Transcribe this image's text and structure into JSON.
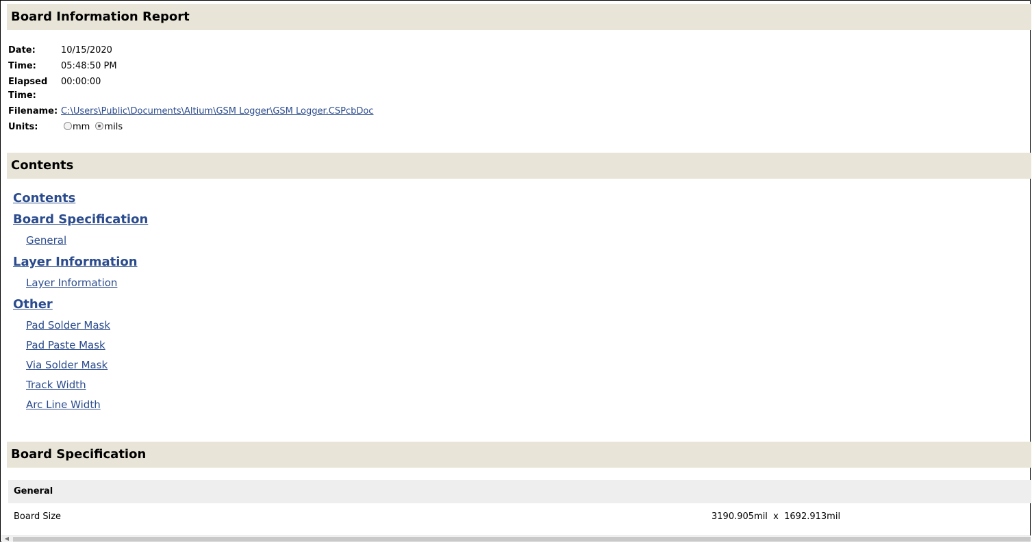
{
  "report": {
    "title": "Board Information Report",
    "meta": {
      "date_label": "Date:",
      "date_value": "10/15/2020",
      "time_label": "Time:",
      "time_value": "05:48:50 PM",
      "elapsed_label_1": "Elapsed",
      "elapsed_label_2": "Time:",
      "elapsed_value": "00:00:00",
      "filename_label": "Filename:",
      "filename_value": "C:\\Users\\Public\\Documents\\Altium\\GSM Logger\\GSM Logger.CSPcbDoc",
      "units_label": "Units:",
      "units_option_mm": "mm",
      "units_option_mils": "mils",
      "units_selected": "mils"
    }
  },
  "contents": {
    "title": "Contents",
    "items": [
      {
        "label": "Contents"
      },
      {
        "label": "Board Specification"
      },
      {
        "label": "General"
      },
      {
        "label": "Layer Information"
      },
      {
        "label": "Layer Information"
      },
      {
        "label": "Other"
      },
      {
        "label": "Pad Solder Mask"
      },
      {
        "label": "Pad Paste Mask"
      },
      {
        "label": "Via Solder Mask"
      },
      {
        "label": "Track Width"
      },
      {
        "label": "Arc Line Width"
      }
    ]
  },
  "board_spec": {
    "title": "Board Specification",
    "general": {
      "title": "General",
      "rows": [
        {
          "label": "Board Size",
          "value": "3190.905mil  x  1692.913mil"
        }
      ]
    }
  }
}
